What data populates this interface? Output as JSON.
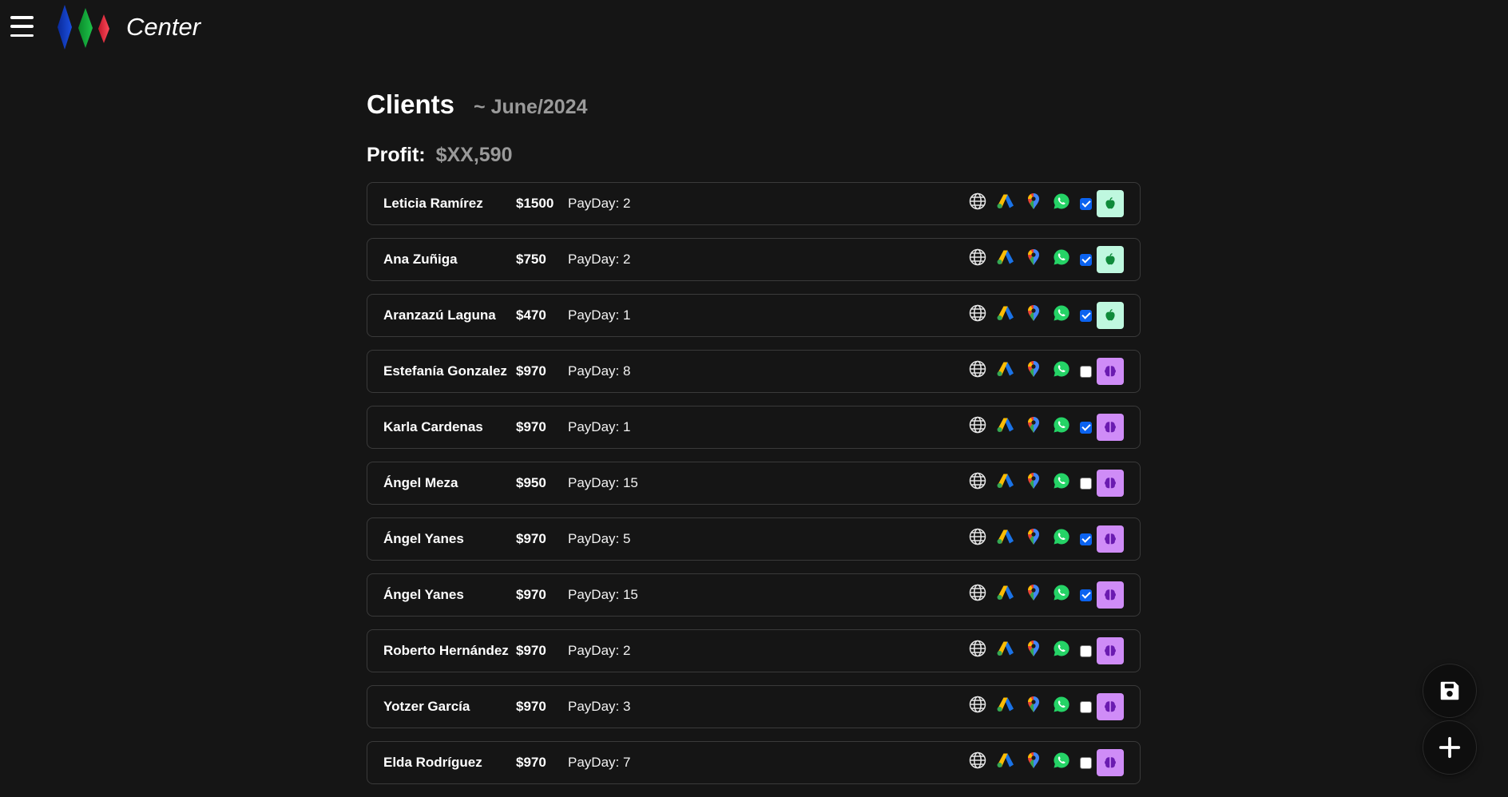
{
  "app": {
    "brand": "Center"
  },
  "page": {
    "title": "Clients",
    "period": "~ June/2024"
  },
  "profit": {
    "label": "Profit:",
    "value": "$XX,590"
  },
  "colors": {
    "apple_badge": "#bff8df",
    "brain_badge": "#cf8cf7",
    "checkbox_on": "#0b63f0"
  },
  "row_icons": [
    "globe-icon",
    "google-ads-icon",
    "google-maps-icon",
    "whatsapp-icon"
  ],
  "clients": [
    {
      "name": "Leticia Ramírez",
      "amount": "$1500",
      "payday": "PayDay: 2",
      "checked": true,
      "badge": "apple"
    },
    {
      "name": "Ana Zuñiga",
      "amount": "$750",
      "payday": "PayDay: 2",
      "checked": true,
      "badge": "apple"
    },
    {
      "name": "Aranzazú Laguna",
      "amount": "$470",
      "payday": "PayDay: 1",
      "checked": true,
      "badge": "apple"
    },
    {
      "name": "Estefanía Gonzalez",
      "amount": "$970",
      "payday": "PayDay: 8",
      "checked": false,
      "badge": "brain"
    },
    {
      "name": "Karla Cardenas",
      "amount": "$970",
      "payday": "PayDay: 1",
      "checked": true,
      "badge": "brain"
    },
    {
      "name": "Ángel Meza",
      "amount": "$950",
      "payday": "PayDay: 15",
      "checked": false,
      "badge": "brain"
    },
    {
      "name": "Ángel Yanes",
      "amount": "$970",
      "payday": "PayDay: 5",
      "checked": true,
      "badge": "brain"
    },
    {
      "name": "Ángel Yanes",
      "amount": "$970",
      "payday": "PayDay: 15",
      "checked": true,
      "badge": "brain"
    },
    {
      "name": "Roberto Hernández",
      "amount": "$970",
      "payday": "PayDay: 2",
      "checked": false,
      "badge": "brain"
    },
    {
      "name": "Yotzer García",
      "amount": "$970",
      "payday": "PayDay: 3",
      "checked": false,
      "badge": "brain"
    },
    {
      "name": "Elda Rodríguez",
      "amount": "$970",
      "payday": "PayDay: 7",
      "checked": false,
      "badge": "brain"
    }
  ],
  "fabs": {
    "save": "save-icon",
    "add": "plus-icon"
  }
}
